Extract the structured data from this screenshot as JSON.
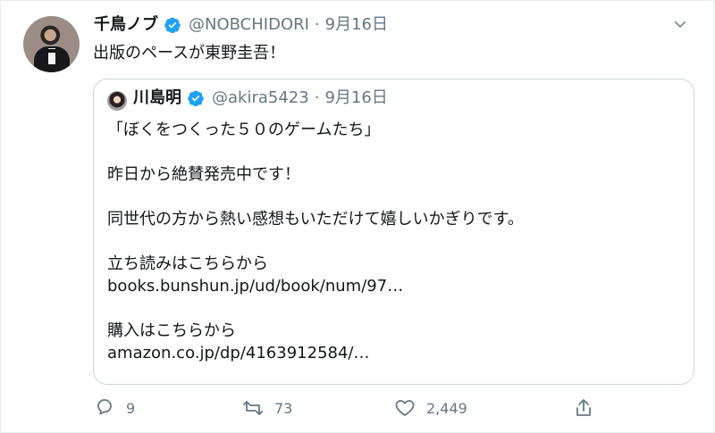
{
  "tweet": {
    "author": {
      "name": "千鳥ノブ",
      "handle": "@NOBCHIDORI",
      "date": "9月16日",
      "avatar": "avatar"
    },
    "text": "出版のペースが東野圭吾！",
    "menu_icon": "chevron-down-icon"
  },
  "quote": {
    "author": {
      "name": "川島明",
      "handle": "@akira5423",
      "date": "9月16日",
      "avatar": "avatar"
    },
    "lines": [
      "「ぼくをつくった５０のゲームたち」",
      "昨日から絶賛発売中です！",
      "同世代の方から熱い感想もいただけて嬉しいかぎりです。",
      "立ち読みはこちらから",
      "books.bunshun.jp/ud/book/num/97…",
      "購入はこちらから",
      "amazon.co.jp/dp/4163912584/…"
    ]
  },
  "actions": {
    "reply_count": "9",
    "retweet_count": "73",
    "like_count": "2,449"
  },
  "colors": {
    "verified": "#1da1f2",
    "muted_text": "#657786",
    "border": "#ccd6dd"
  }
}
